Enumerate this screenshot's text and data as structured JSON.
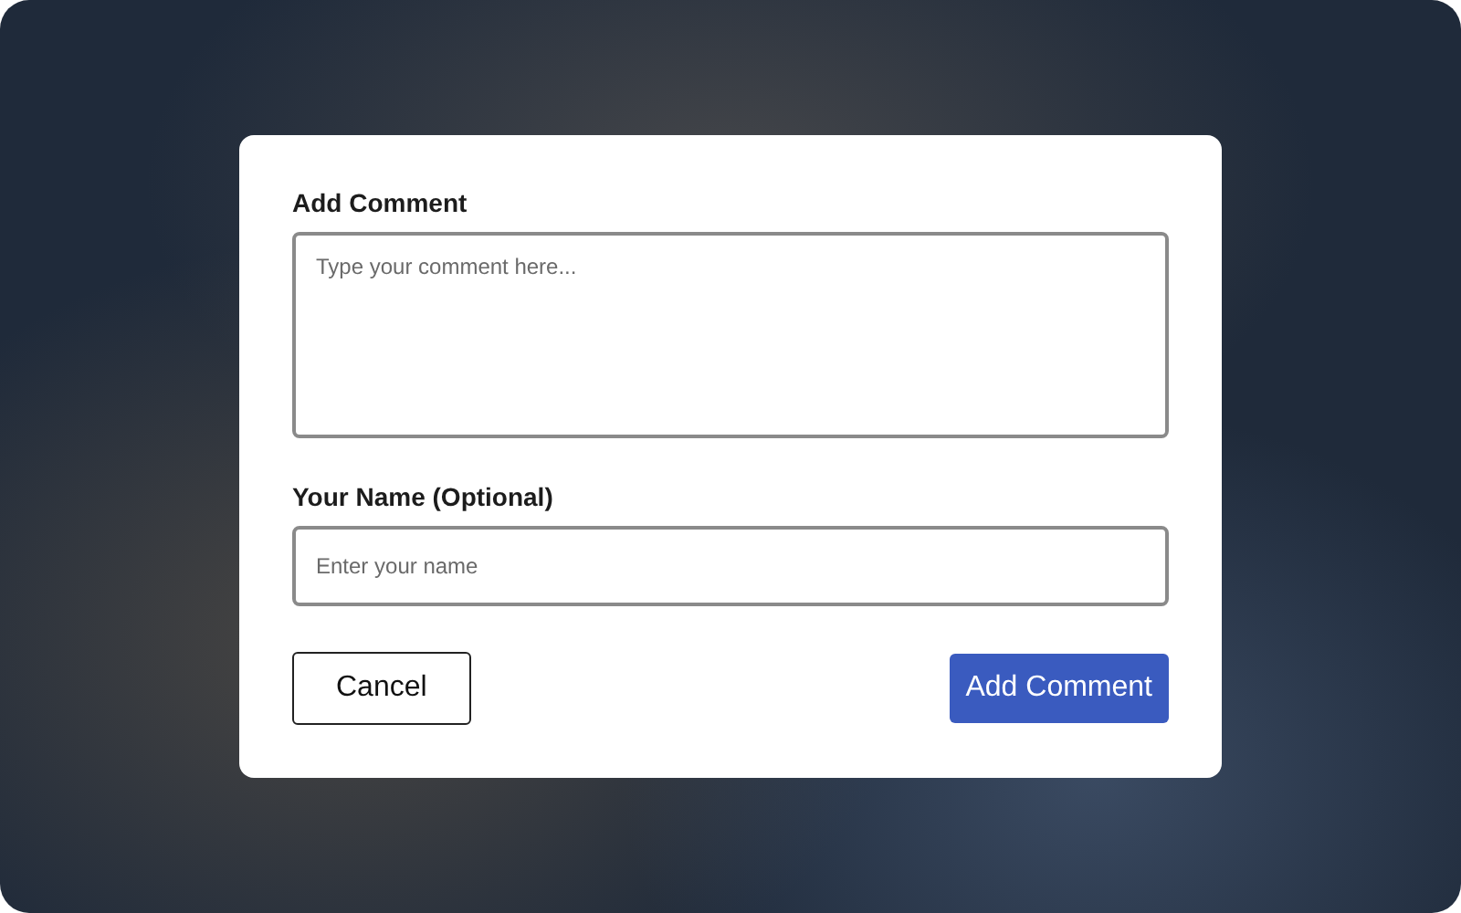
{
  "dialog": {
    "comment_label": "Add Comment",
    "comment_placeholder": "Type your comment here...",
    "name_label": "Your Name (Optional)",
    "name_placeholder": "Enter your name",
    "buttons": [
      {
        "label": "Cancel",
        "kind": "secondary"
      },
      {
        "label": "Add Comment",
        "kind": "primary"
      }
    ]
  }
}
